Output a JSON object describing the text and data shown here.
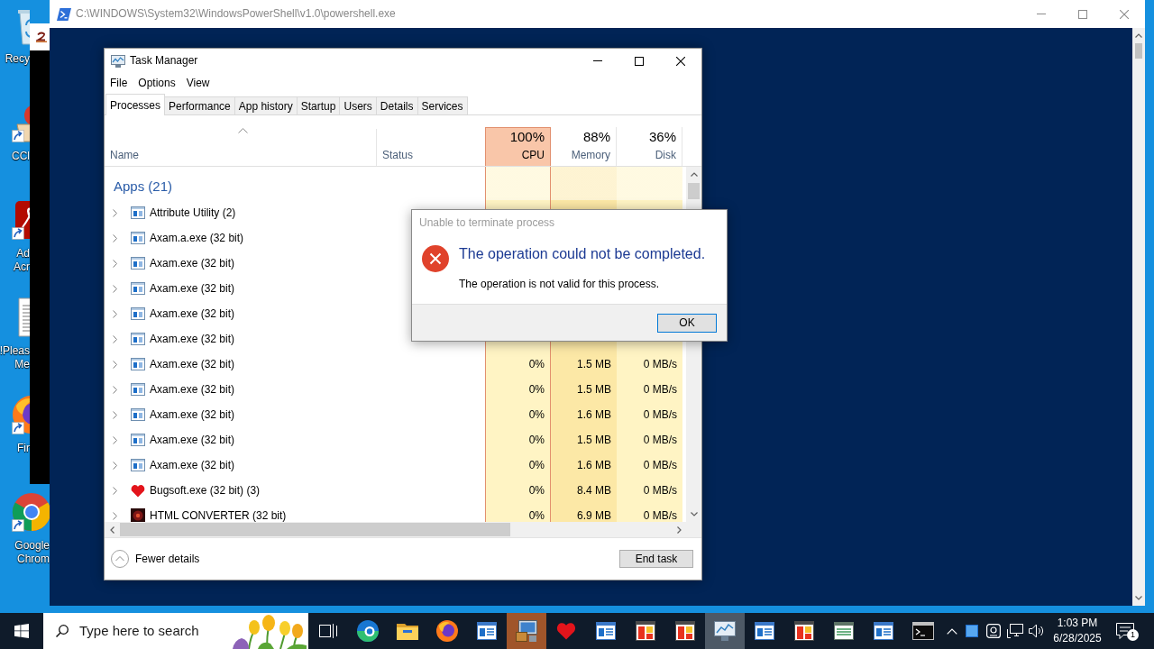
{
  "desktop": {
    "icons": [
      {
        "label": "Recy",
        "kind": "bin",
        "shortcut": false
      },
      {
        "label": "CCl",
        "kind": "cleaner",
        "shortcut": true
      },
      {
        "label": "Ad\nAcr",
        "kind": "reader",
        "shortcut": true
      },
      {
        "label": "!Pleas\nMe",
        "kind": "text-file",
        "shortcut": false
      },
      {
        "label": "Fir",
        "kind": "fox",
        "shortcut": true
      },
      {
        "label": "Google\nChrom",
        "kind": "chrome",
        "shortcut": true
      }
    ]
  },
  "powershell": {
    "title": "C:\\WINDOWS\\System32\\WindowsPowerShell\\v1.0\\powershell.exe",
    "active": false
  },
  "task_manager": {
    "title": "Task Manager",
    "active": true,
    "menu": [
      "File",
      "Options",
      "View"
    ],
    "tabs": [
      {
        "label": "Processes",
        "selected": true
      },
      {
        "label": "Performance",
        "selected": false
      },
      {
        "label": "App history",
        "selected": false
      },
      {
        "label": "Startup",
        "selected": false
      },
      {
        "label": "Users",
        "selected": false
      },
      {
        "label": "Details",
        "selected": false
      },
      {
        "label": "Services",
        "selected": false
      }
    ],
    "columns": [
      {
        "kind": "text",
        "label": "Name",
        "sorted": true
      },
      {
        "kind": "text",
        "label": "Status",
        "sorted": false
      },
      {
        "kind": "metric",
        "label": "CPU",
        "total": "100%",
        "alert": true,
        "color": "#fff4c4"
      },
      {
        "kind": "metric",
        "label": "Memory",
        "total": "88%",
        "alert": false,
        "color": "#fce8a6"
      },
      {
        "kind": "metric",
        "label": "Disk",
        "total": "36%",
        "alert": false,
        "color": "#fff4c4"
      }
    ],
    "group_label": "Apps (21)",
    "rows": [
      {
        "name": "Attribute Utility (2)",
        "kind": "app",
        "expanded": false
      },
      {
        "name": "Axam.a.exe (32 bit)",
        "kind": "app",
        "expanded": false
      },
      {
        "name": "Axam.exe (32 bit)",
        "kind": "app",
        "expanded": false
      },
      {
        "name": "Axam.exe (32 bit)",
        "kind": "app",
        "expanded": false
      },
      {
        "name": "Axam.exe (32 bit)",
        "kind": "app",
        "expanded": false
      },
      {
        "name": "Axam.exe (32 bit)",
        "kind": "app",
        "expanded": false
      },
      {
        "name": "Axam.exe (32 bit)",
        "kind": "app",
        "expanded": false,
        "values": [
          "0%",
          "1.5 MB",
          "0 MB/s"
        ]
      },
      {
        "name": "Axam.exe (32 bit)",
        "kind": "app",
        "expanded": false,
        "values": [
          "0%",
          "1.5 MB",
          "0 MB/s"
        ]
      },
      {
        "name": "Axam.exe (32 bit)",
        "kind": "app",
        "expanded": false,
        "values": [
          "0%",
          "1.6 MB",
          "0 MB/s"
        ]
      },
      {
        "name": "Axam.exe (32 bit)",
        "kind": "app",
        "expanded": false,
        "values": [
          "0%",
          "1.5 MB",
          "0 MB/s"
        ]
      },
      {
        "name": "Axam.exe (32 bit)",
        "kind": "app",
        "expanded": false,
        "values": [
          "0%",
          "1.6 MB",
          "0 MB/s"
        ]
      },
      {
        "name": "Bugsoft.exe (32 bit) (3)",
        "kind": "heart",
        "expanded": false,
        "values": [
          "0%",
          "8.4 MB",
          "0 MB/s"
        ]
      },
      {
        "name": "HTML CONVERTER (32 bit)",
        "kind": "converter",
        "expanded": false,
        "values": [
          "0%",
          "6.9 MB",
          "0 MB/s"
        ]
      }
    ],
    "fewer_details": "Fewer details",
    "end_task": "End task"
  },
  "dialog": {
    "title": "Unable to terminate process",
    "heading": "The operation could not be completed.",
    "message": "The operation is not valid for this process.",
    "buttons": [
      {
        "label": "OK",
        "default": true
      }
    ]
  },
  "taskbar": {
    "search_placeholder": "Type here to search",
    "apps": [
      {
        "kind": "edge",
        "active": false,
        "attention": false
      },
      {
        "kind": "folder",
        "active": false,
        "attention": false
      },
      {
        "kind": "fox",
        "active": false,
        "attention": false
      },
      {
        "kind": "window",
        "active": false,
        "attention": false
      },
      {
        "kind": "installer",
        "active": false,
        "attention": true
      },
      {
        "kind": "heart",
        "active": false,
        "attention": false
      },
      {
        "kind": "window",
        "active": false,
        "attention": false
      },
      {
        "kind": "tiles",
        "active": false,
        "attention": false
      },
      {
        "kind": "tiles",
        "active": false,
        "attention": false
      },
      {
        "kind": "monitor",
        "active": true,
        "attention": false
      },
      {
        "kind": "window",
        "active": false,
        "attention": false
      },
      {
        "kind": "tiles",
        "active": false,
        "attention": false
      },
      {
        "kind": "sheet",
        "active": false,
        "attention": false
      },
      {
        "kind": "window",
        "active": false,
        "attention": false
      },
      {
        "kind": "terminal",
        "active": false,
        "attention": false
      }
    ],
    "time": "1:03 PM",
    "date": "6/28/2025",
    "notification_count": "1"
  }
}
